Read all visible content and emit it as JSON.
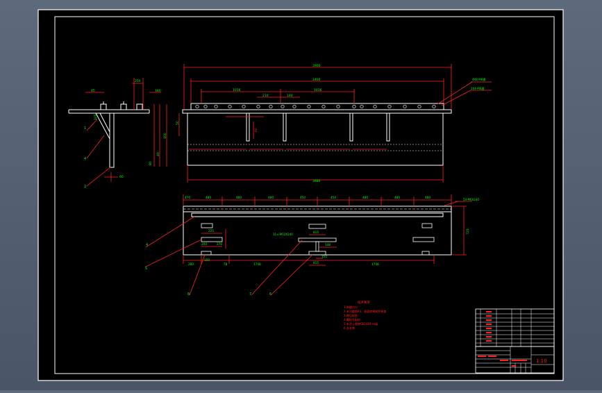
{
  "drawing": {
    "front_view": {
      "overall_length": "3900",
      "length_2400": "2400",
      "span_1016_left": "1016",
      "span_210": "210",
      "span_140": "140",
      "span_1016_right": "1016",
      "bottom_length": "3880",
      "hole_callout_top": "4X8-M6通",
      "hole_callout_second": "2X4-M6通",
      "height_left": "50",
      "small_dim": "60"
    },
    "side_view": {
      "dim_45": "45",
      "dim_250": "250",
      "dim_180": "180",
      "dim_100": "100",
      "dim_105": "105",
      "dim_80": "80",
      "dim_40": "40",
      "dim_60": "60",
      "part_labels": [
        "1",
        "4",
        "2"
      ]
    },
    "plan_view": {
      "top_dims": [
        "470",
        "480",
        "480",
        "480",
        "450",
        "450",
        "480",
        "480",
        "480"
      ],
      "right_dim": "725",
      "hole_callout_right": "5X-M6X240",
      "hole_callout_mid": "11×-M12X240",
      "dim_815_top": "815",
      "dim_815_bottom": "815",
      "dim_148": "148",
      "dim_150": "150",
      "dim_1748_left": "1748",
      "dim_1748_right": "1748",
      "dim_280": "280",
      "dim_78": "78",
      "dim_225": "225",
      "dim_200": "200",
      "dim_270": "270",
      "dim_150_vert": "150",
      "part_labels": [
        "4",
        "5",
        "8",
        "7",
        "6"
      ]
    },
    "notes": {
      "title": "技术要求",
      "lines": [
        "1.焊缝均匀",
        "2.未注圆角R3，表面除锈刷防锈漆",
        "3.焊后校直",
        "4.螺栓孔配钻",
        "5.未注公差按GB1804-m级",
        "6.去毛刺"
      ]
    },
    "title_block": {
      "scale": "1:10"
    }
  }
}
